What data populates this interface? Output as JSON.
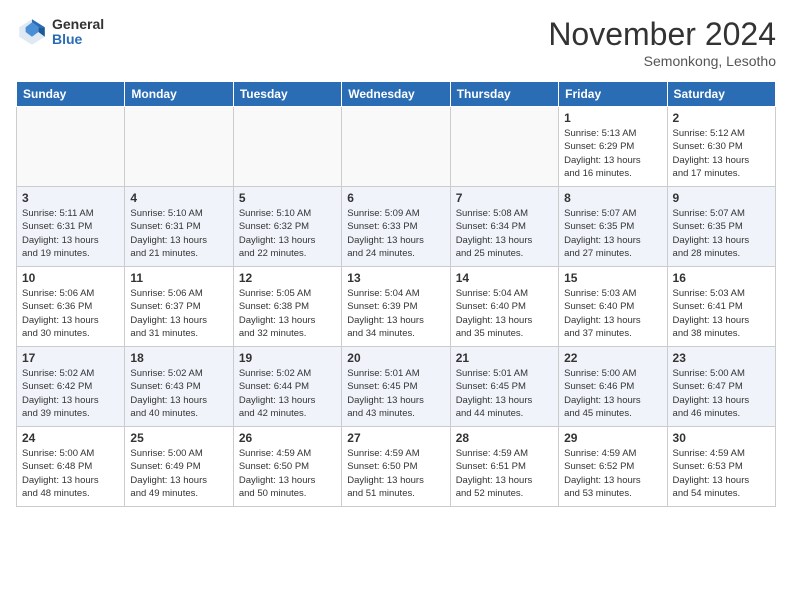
{
  "header": {
    "logo": {
      "general": "General",
      "blue": "Blue"
    },
    "title": "November 2024",
    "location": "Semonkong, Lesotho"
  },
  "weekdays": [
    "Sunday",
    "Monday",
    "Tuesday",
    "Wednesday",
    "Thursday",
    "Friday",
    "Saturday"
  ],
  "weeks": [
    [
      {
        "day": "",
        "info": ""
      },
      {
        "day": "",
        "info": ""
      },
      {
        "day": "",
        "info": ""
      },
      {
        "day": "",
        "info": ""
      },
      {
        "day": "",
        "info": ""
      },
      {
        "day": "1",
        "info": "Sunrise: 5:13 AM\nSunset: 6:29 PM\nDaylight: 13 hours\nand 16 minutes."
      },
      {
        "day": "2",
        "info": "Sunrise: 5:12 AM\nSunset: 6:30 PM\nDaylight: 13 hours\nand 17 minutes."
      }
    ],
    [
      {
        "day": "3",
        "info": "Sunrise: 5:11 AM\nSunset: 6:31 PM\nDaylight: 13 hours\nand 19 minutes."
      },
      {
        "day": "4",
        "info": "Sunrise: 5:10 AM\nSunset: 6:31 PM\nDaylight: 13 hours\nand 21 minutes."
      },
      {
        "day": "5",
        "info": "Sunrise: 5:10 AM\nSunset: 6:32 PM\nDaylight: 13 hours\nand 22 minutes."
      },
      {
        "day": "6",
        "info": "Sunrise: 5:09 AM\nSunset: 6:33 PM\nDaylight: 13 hours\nand 24 minutes."
      },
      {
        "day": "7",
        "info": "Sunrise: 5:08 AM\nSunset: 6:34 PM\nDaylight: 13 hours\nand 25 minutes."
      },
      {
        "day": "8",
        "info": "Sunrise: 5:07 AM\nSunset: 6:35 PM\nDaylight: 13 hours\nand 27 minutes."
      },
      {
        "day": "9",
        "info": "Sunrise: 5:07 AM\nSunset: 6:35 PM\nDaylight: 13 hours\nand 28 minutes."
      }
    ],
    [
      {
        "day": "10",
        "info": "Sunrise: 5:06 AM\nSunset: 6:36 PM\nDaylight: 13 hours\nand 30 minutes."
      },
      {
        "day": "11",
        "info": "Sunrise: 5:06 AM\nSunset: 6:37 PM\nDaylight: 13 hours\nand 31 minutes."
      },
      {
        "day": "12",
        "info": "Sunrise: 5:05 AM\nSunset: 6:38 PM\nDaylight: 13 hours\nand 32 minutes."
      },
      {
        "day": "13",
        "info": "Sunrise: 5:04 AM\nSunset: 6:39 PM\nDaylight: 13 hours\nand 34 minutes."
      },
      {
        "day": "14",
        "info": "Sunrise: 5:04 AM\nSunset: 6:40 PM\nDaylight: 13 hours\nand 35 minutes."
      },
      {
        "day": "15",
        "info": "Sunrise: 5:03 AM\nSunset: 6:40 PM\nDaylight: 13 hours\nand 37 minutes."
      },
      {
        "day": "16",
        "info": "Sunrise: 5:03 AM\nSunset: 6:41 PM\nDaylight: 13 hours\nand 38 minutes."
      }
    ],
    [
      {
        "day": "17",
        "info": "Sunrise: 5:02 AM\nSunset: 6:42 PM\nDaylight: 13 hours\nand 39 minutes."
      },
      {
        "day": "18",
        "info": "Sunrise: 5:02 AM\nSunset: 6:43 PM\nDaylight: 13 hours\nand 40 minutes."
      },
      {
        "day": "19",
        "info": "Sunrise: 5:02 AM\nSunset: 6:44 PM\nDaylight: 13 hours\nand 42 minutes."
      },
      {
        "day": "20",
        "info": "Sunrise: 5:01 AM\nSunset: 6:45 PM\nDaylight: 13 hours\nand 43 minutes."
      },
      {
        "day": "21",
        "info": "Sunrise: 5:01 AM\nSunset: 6:45 PM\nDaylight: 13 hours\nand 44 minutes."
      },
      {
        "day": "22",
        "info": "Sunrise: 5:00 AM\nSunset: 6:46 PM\nDaylight: 13 hours\nand 45 minutes."
      },
      {
        "day": "23",
        "info": "Sunrise: 5:00 AM\nSunset: 6:47 PM\nDaylight: 13 hours\nand 46 minutes."
      }
    ],
    [
      {
        "day": "24",
        "info": "Sunrise: 5:00 AM\nSunset: 6:48 PM\nDaylight: 13 hours\nand 48 minutes."
      },
      {
        "day": "25",
        "info": "Sunrise: 5:00 AM\nSunset: 6:49 PM\nDaylight: 13 hours\nand 49 minutes."
      },
      {
        "day": "26",
        "info": "Sunrise: 4:59 AM\nSunset: 6:50 PM\nDaylight: 13 hours\nand 50 minutes."
      },
      {
        "day": "27",
        "info": "Sunrise: 4:59 AM\nSunset: 6:50 PM\nDaylight: 13 hours\nand 51 minutes."
      },
      {
        "day": "28",
        "info": "Sunrise: 4:59 AM\nSunset: 6:51 PM\nDaylight: 13 hours\nand 52 minutes."
      },
      {
        "day": "29",
        "info": "Sunrise: 4:59 AM\nSunset: 6:52 PM\nDaylight: 13 hours\nand 53 minutes."
      },
      {
        "day": "30",
        "info": "Sunrise: 4:59 AM\nSunset: 6:53 PM\nDaylight: 13 hours\nand 54 minutes."
      }
    ]
  ]
}
